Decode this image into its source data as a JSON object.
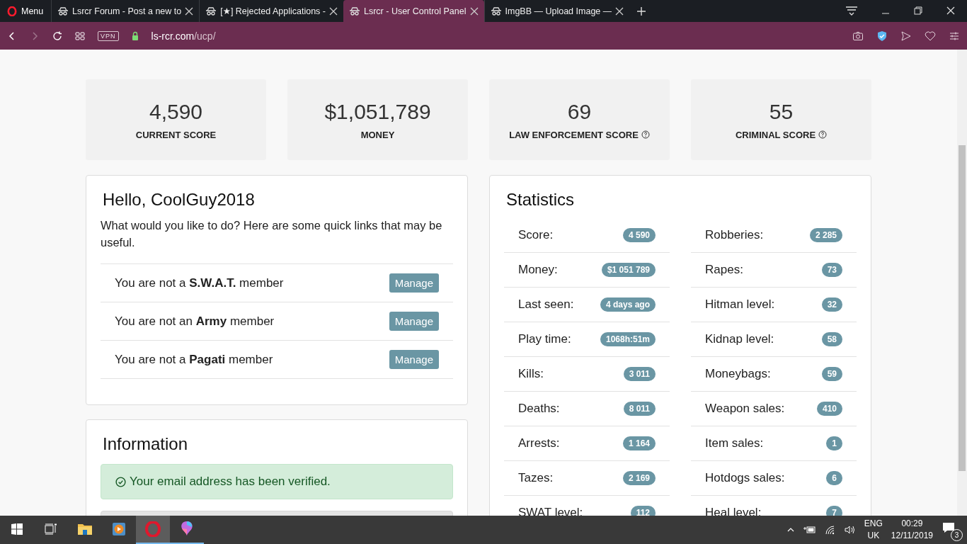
{
  "browser": {
    "menu_label": "Menu",
    "tabs": [
      {
        "title": "Lsrcr Forum - Post a new to",
        "selected": false
      },
      {
        "title": "[★] Rejected Applications -",
        "selected": false
      },
      {
        "title": "Lsrcr - User Control Panel",
        "selected": true
      },
      {
        "title": "ImgBB — Upload Image —",
        "selected": false
      }
    ],
    "vpn": "VPN",
    "url_host": "ls-rcr.com",
    "url_path": "/ucp/"
  },
  "score_cards": [
    {
      "value": "4,590",
      "label": "CURRENT SCORE",
      "help": false
    },
    {
      "value": "$1,051,789",
      "label": "MONEY",
      "help": false
    },
    {
      "value": "69",
      "label": "LAW ENFORCEMENT SCORE",
      "help": true
    },
    {
      "value": "55",
      "label": "CRIMINAL SCORE",
      "help": true
    }
  ],
  "hello": {
    "title": "Hello, CoolGuy2018",
    "intro": "What would you like to do? Here are some quick links that may be useful.",
    "memberships": [
      {
        "text": "You are not a **S.W.A.T.** member",
        "button": "Manage"
      },
      {
        "text": "You are not an **Army** member",
        "button": "Manage"
      },
      {
        "text": "You are not a **Pagati** member",
        "button": "Manage"
      }
    ]
  },
  "information": {
    "title": "Information",
    "alert": "Your email address has been verified."
  },
  "statistics": {
    "title": "Statistics",
    "columns": [
      [
        {
          "label": "Score:",
          "value": "4 590"
        },
        {
          "label": "Money:",
          "value": "$1 051 789"
        },
        {
          "label": "Last seen:",
          "value": "4 days ago"
        },
        {
          "label": "Play time:",
          "value": "1068h:51m"
        },
        {
          "label": "Kills:",
          "value": "3 011"
        },
        {
          "label": "Deaths:",
          "value": "8 011"
        },
        {
          "label": "Arrests:",
          "value": "1 164"
        },
        {
          "label": "Tazes:",
          "value": "2 169"
        },
        {
          "label": "SWAT level:",
          "value": "112"
        }
      ],
      [
        {
          "label": "Robberies:",
          "value": "2 285"
        },
        {
          "label": "Rapes:",
          "value": "73"
        },
        {
          "label": "Hitman level:",
          "value": "32"
        },
        {
          "label": "Kidnap level:",
          "value": "58"
        },
        {
          "label": "Moneybags:",
          "value": "59"
        },
        {
          "label": "Weapon sales:",
          "value": "410"
        },
        {
          "label": "Item sales:",
          "value": "1"
        },
        {
          "label": "Hotdogs sales:",
          "value": "6"
        },
        {
          "label": "Heal level:",
          "value": "7"
        }
      ]
    ]
  },
  "taskbar": {
    "apps": [
      {
        "kind": "start",
        "active": false,
        "running": false
      },
      {
        "kind": "taskview",
        "active": false,
        "running": false
      },
      {
        "kind": "explorer",
        "active": false,
        "running": false
      },
      {
        "kind": "media",
        "active": false,
        "running": false
      },
      {
        "kind": "opera",
        "active": true,
        "running": true
      },
      {
        "kind": "balloon",
        "active": false,
        "running": true
      }
    ],
    "language": "ENG",
    "region": "UK",
    "time": "00:29",
    "date": "12/11/2019",
    "notifications": "3"
  }
}
